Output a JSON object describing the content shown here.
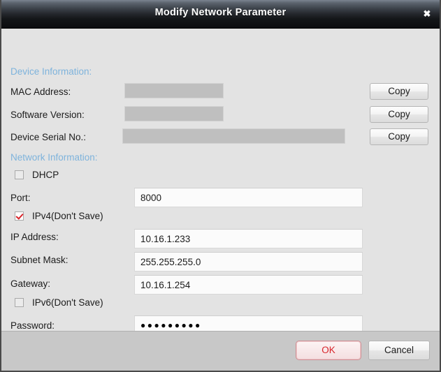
{
  "window": {
    "title": "Modify Network Parameter",
    "close_icon": "close-icon",
    "close_glyph": "✖"
  },
  "colors": {
    "section_heading": "#7EB3DC",
    "accent_red": "#D8232A",
    "titlebar_dark": "#0C0D10",
    "body_bg": "#E3E3E3",
    "footer_bg": "#C8C8C8",
    "redacted_fill": "#BFBFBF"
  },
  "device_information": {
    "heading": "Device Information:",
    "rows": [
      {
        "label": "MAC Address:",
        "value": "",
        "redacted": true,
        "copy_label": "Copy"
      },
      {
        "label": "Software Version:",
        "value": "",
        "redacted": true,
        "copy_label": "Copy"
      },
      {
        "label": "Device Serial No.:",
        "value": "",
        "redacted": true,
        "copy_label": "Copy"
      }
    ]
  },
  "network_information": {
    "heading": "Network Information:",
    "dhcp": {
      "label": "DHCP",
      "checked": false
    },
    "port": {
      "label": "Port:",
      "value": "8000",
      "placeholder": ""
    },
    "ipv4_dont_save": {
      "label": "IPv4(Don't Save)",
      "checked": true
    },
    "ip_address": {
      "label": "IP Address:",
      "value": "10.16.1.233",
      "placeholder": ""
    },
    "subnet_mask": {
      "label": "Subnet Mask:",
      "value": "255.255.255.0",
      "placeholder": ""
    },
    "gateway": {
      "label": "Gateway:",
      "value": "10.16.1.254",
      "placeholder": ""
    },
    "ipv6_dont_save": {
      "label": "IPv6(Don't Save)",
      "checked": false
    },
    "password": {
      "label": "Password:",
      "value": "●●●●●●●●●",
      "placeholder": ""
    }
  },
  "footer": {
    "ok_label": "OK",
    "cancel_label": "Cancel"
  }
}
